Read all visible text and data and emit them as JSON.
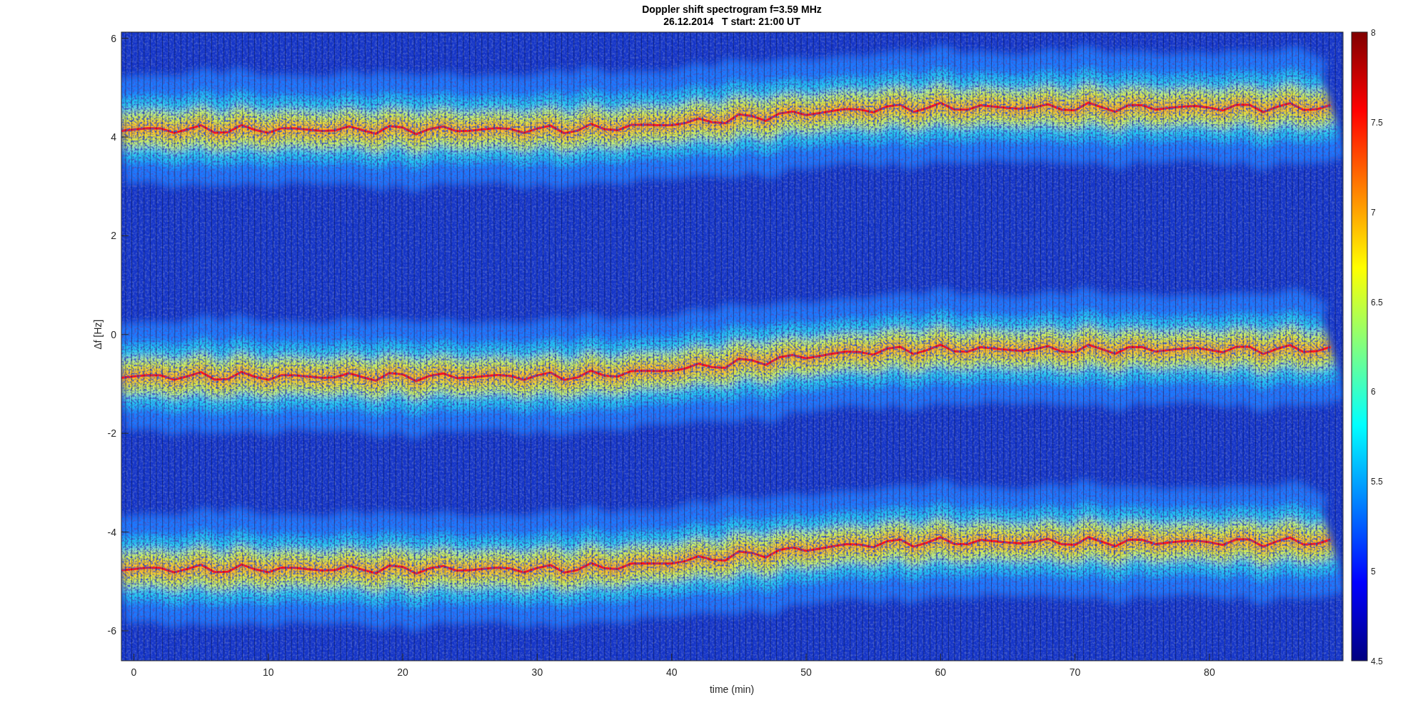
{
  "title": [
    "Doppler shift spectrogram f=3.59 MHz",
    "26.12.2014   T start: 21:00 UT"
  ],
  "xlabel": "time (min)",
  "ylabel": "Δf [Hz]",
  "xticks": [
    "0",
    "10",
    "20",
    "30",
    "40",
    "50",
    "60",
    "70",
    "80"
  ],
  "yticks": [
    "6",
    "4",
    "2",
    "0",
    "-2",
    "-4",
    "-6"
  ],
  "colorbar_ticks": [
    "8",
    "7.5",
    "7",
    "6.5",
    "6",
    "5.5",
    "5",
    "4.5"
  ]
}
